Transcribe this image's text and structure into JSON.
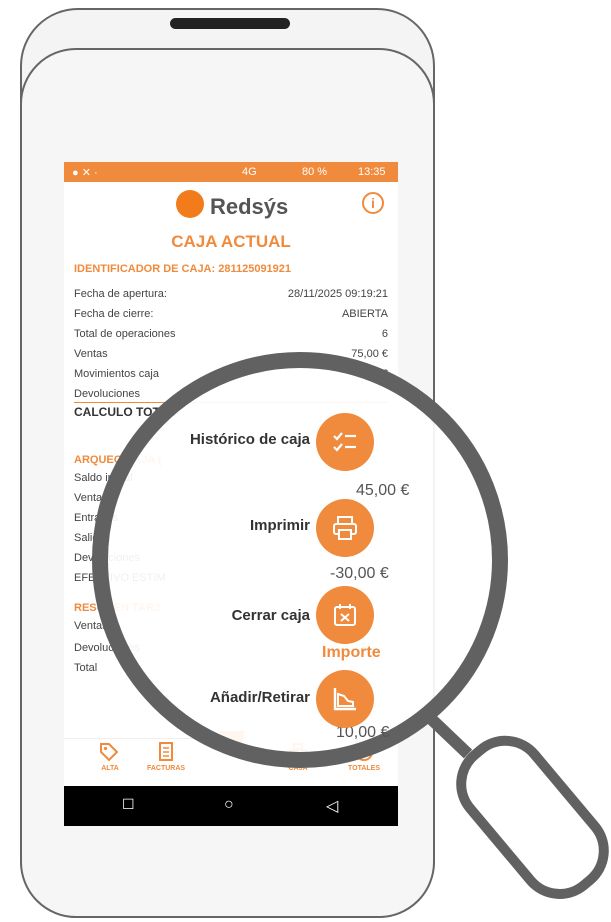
{
  "status_bar": {
    "network": "4G",
    "battery": "80 %",
    "time": "13:35"
  },
  "brand": {
    "name": "Redsýs",
    "info_glyph": "i"
  },
  "page_title": "CAJA ACTUAL",
  "identifier_label": "IDENTIFICADOR DE CAJA: 281125091921",
  "details": [
    {
      "label": "Fecha de apertura:",
      "value": "28/11/2025 09:19:21"
    },
    {
      "label": "Fecha de cierre:",
      "value": "ABIERTA"
    },
    {
      "label": "Total de operaciones",
      "value": "6"
    },
    {
      "label": "Ventas",
      "value": "75,00 €"
    },
    {
      "label": "Movimientos caja",
      "value": "0,00 €"
    },
    {
      "label": "Devoluciones",
      "value": ""
    }
  ],
  "calculo_total": "CALCULO TOTAL",
  "arqueo": {
    "title": "ARQUEO CAJA (",
    "rows": [
      "Saldo inicial",
      "Ventas",
      "Entradas",
      "Salidas",
      "Devoluciones",
      "EFECTIVO ESTIM"
    ]
  },
  "resumen": {
    "title": "RESUMEN TARJ",
    "rows": [
      "Ventas",
      "Devoluciones",
      "Total"
    ],
    "importe_header": "Importe"
  },
  "visible_amounts": {
    "ventas_arqueo": "45,00 €",
    "efectivo_estimado": "-30,00 €",
    "bottom": "10,00 €"
  },
  "speed_dial": [
    {
      "label": "Histórico de caja",
      "icon": "checklist-icon"
    },
    {
      "label": "Imprimir",
      "icon": "printer-icon"
    },
    {
      "label": "Cerrar caja",
      "icon": "calendar-close-icon"
    },
    {
      "label": "Añadir/Retirar",
      "icon": "chart-area-icon"
    }
  ],
  "bottom_nav": [
    {
      "label": "ALTA",
      "icon": "tag-icon"
    },
    {
      "label": "FACTURAS",
      "icon": "receipt-icon"
    },
    {
      "label": "CAJA",
      "icon": "cash-register-icon"
    },
    {
      "label": "TOTALES",
      "icon": "totals-icon"
    }
  ],
  "colors": {
    "accent": "#f08a3c",
    "text": "#444444",
    "frame": "#666666"
  }
}
